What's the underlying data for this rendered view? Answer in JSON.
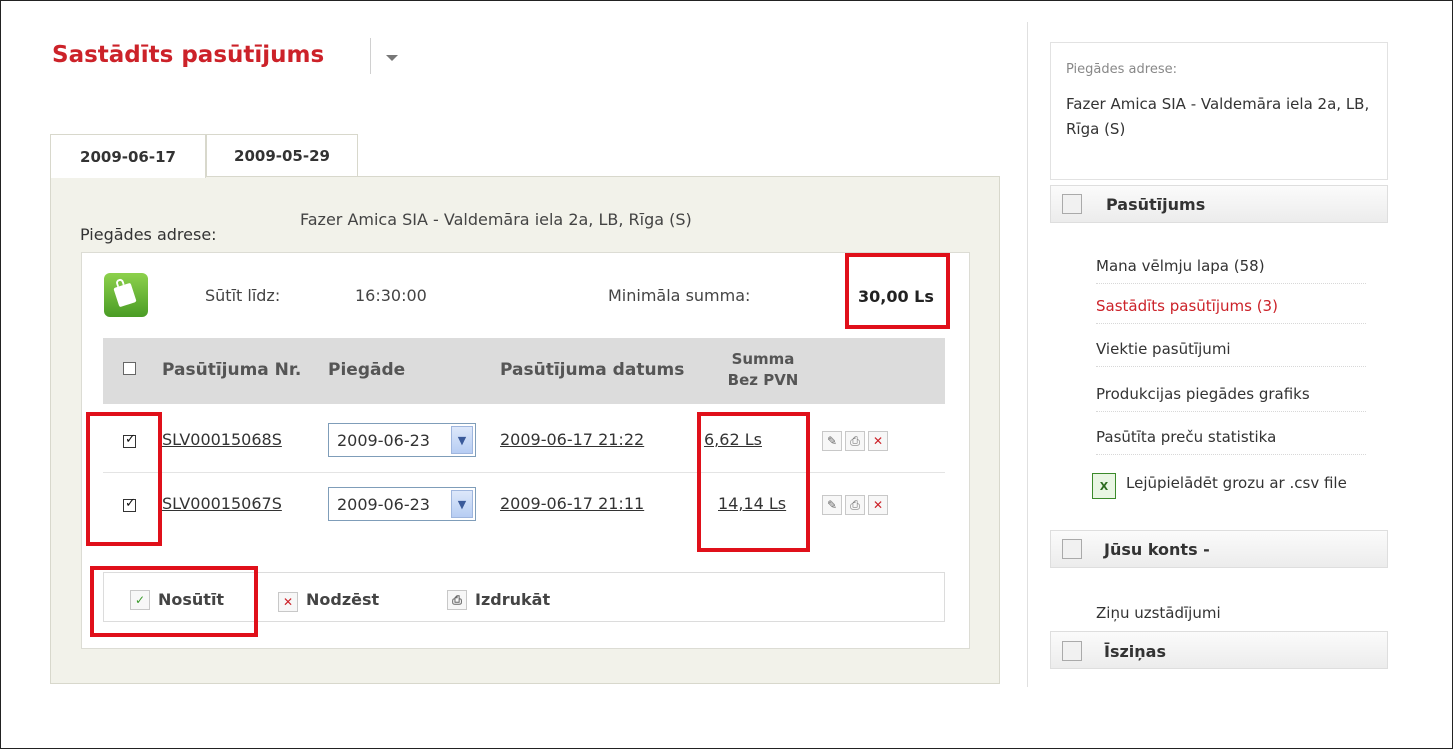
{
  "header": {
    "title": "Sastādīts pasūtījums"
  },
  "tabs": [
    {
      "label": "2009-06-17",
      "active": true
    },
    {
      "label": "2009-05-29",
      "active": false
    }
  ],
  "delivery": {
    "label": "Piegādes adrese:",
    "value": "Fazer Amica SIA - Valdemāra iela 2a, LB, Rīga (S)"
  },
  "info": {
    "send_until_label": "Sūtīt līdz:",
    "send_until_value": "16:30:00",
    "min_sum_label": "Minimāla summa:",
    "min_sum_value": "30,00 Ls"
  },
  "table": {
    "headers": {
      "number": "Pasūtījuma Nr.",
      "delivery": "Piegāde",
      "date": "Pasūtījuma datums",
      "sum_line1": "Summa",
      "sum_line2": "Bez PVN"
    },
    "rows": [
      {
        "checked": true,
        "number": "SLV00015068S",
        "delivery": "2009-06-23",
        "date": "2009-06-17 21:22",
        "sum": "6,62 Ls"
      },
      {
        "checked": true,
        "number": "SLV00015067S",
        "delivery": "2009-06-23",
        "date": "2009-06-17 21:11",
        "sum": "14,14 Ls"
      }
    ]
  },
  "actions": {
    "send": "Nosūtīt",
    "delete": "Nodzēst",
    "print": "Izdrukāt"
  },
  "sidebar": {
    "address_label": "Piegādes adrese:",
    "address_value": "Fazer Amica SIA - Valdemāra iela 2a, LB, Rīga (S)",
    "orders_heading": "Pasūtījums",
    "orders_items": [
      {
        "label": "Mana vēlmju lapa (58)"
      },
      {
        "label": "Sastādīts pasūtījums (3)"
      },
      {
        "label": "Viektie pasūtījumi"
      },
      {
        "label": "Produkcijas piegādes grafiks"
      },
      {
        "label": "Pasūtīta preču statistika"
      }
    ],
    "csv_label": "Lejūpielādēt grozu ar .csv file",
    "account_heading": "Jūsu konts -",
    "account_items": [
      {
        "label": "Ziņu uzstādījumi"
      }
    ],
    "messages_heading": "Īsziņas"
  },
  "colors": {
    "brand_red": "#cc2229",
    "highlight_red": "#e0101a",
    "panel_bg": "#f2f2ea"
  }
}
